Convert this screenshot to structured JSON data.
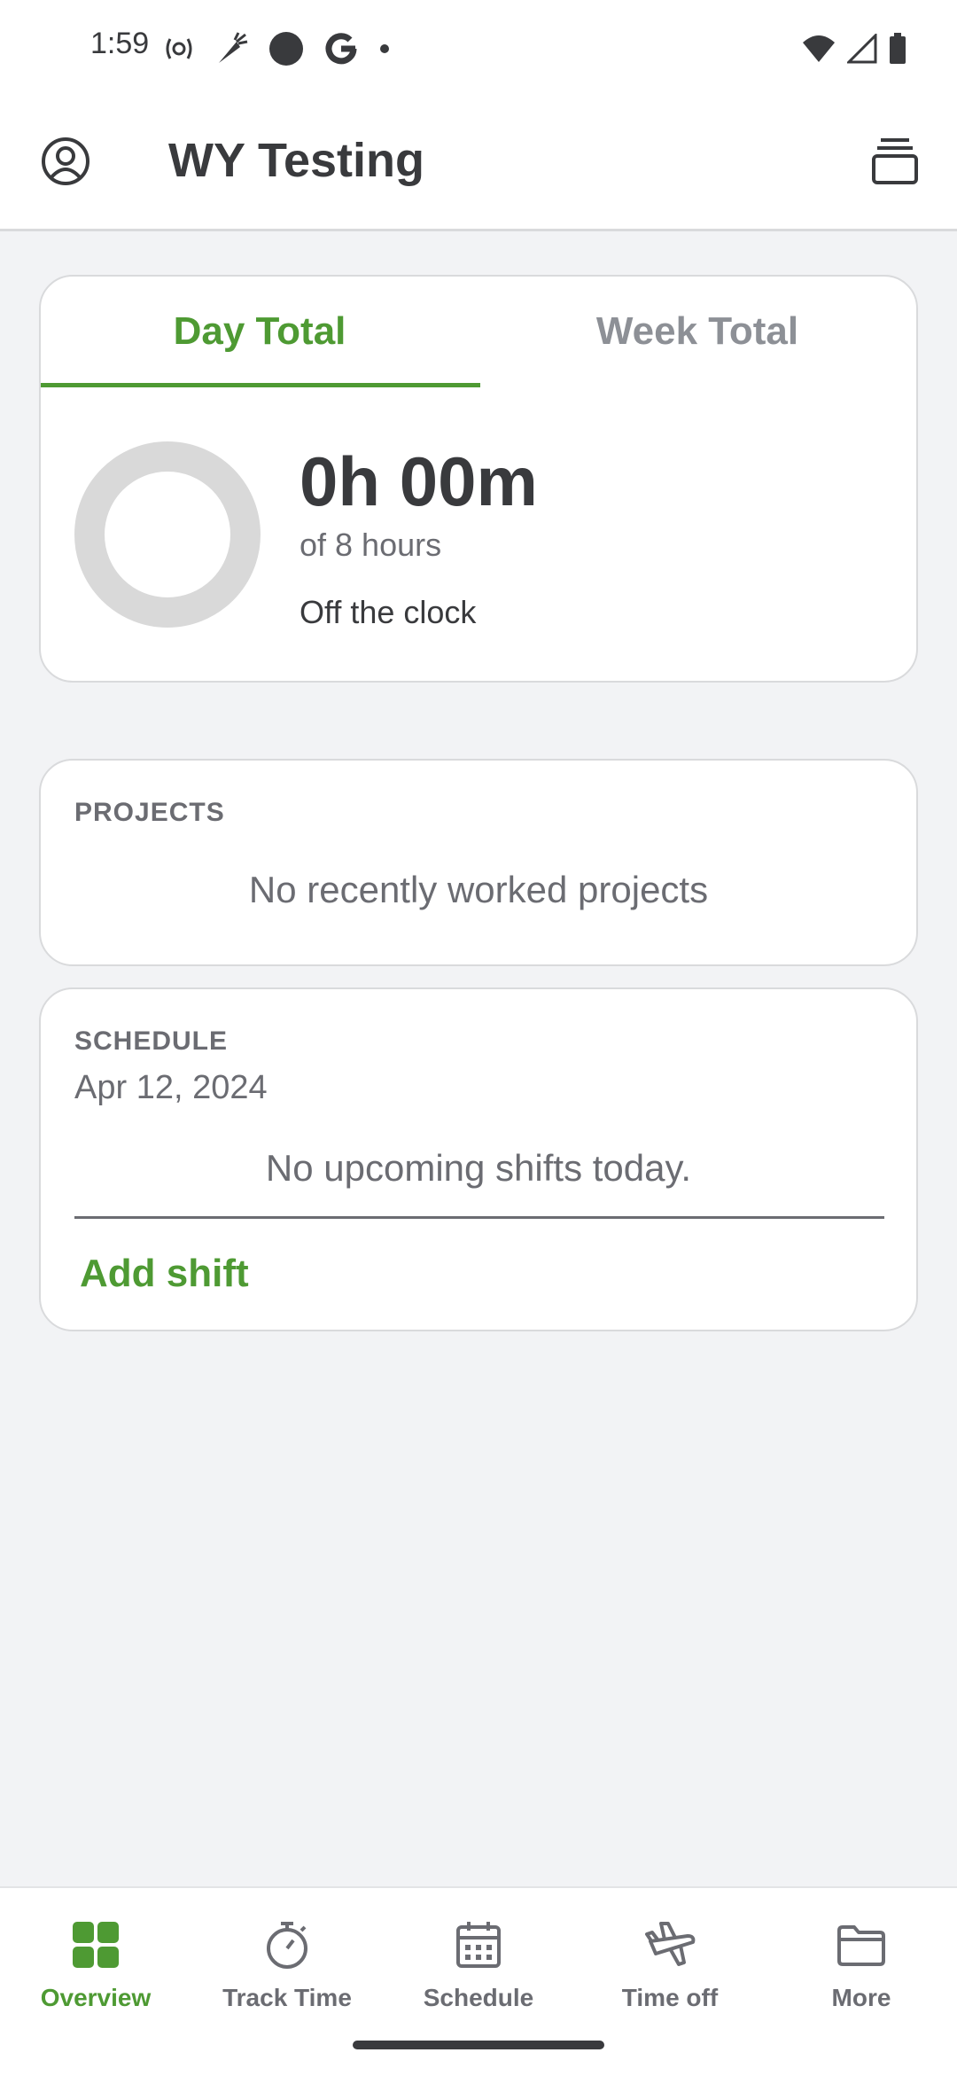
{
  "status_bar": {
    "time": "1:59",
    "left_icons": [
      "hotspot-icon",
      "carrot-icon",
      "dot-icon",
      "google-icon",
      "small-dot-icon"
    ],
    "right_icons": [
      "wifi-icon",
      "cell-signal-icon",
      "battery-icon"
    ]
  },
  "app_bar": {
    "title": "WY Testing",
    "left_icon": "profile-icon",
    "right_icon": "company-switch-icon"
  },
  "summary": {
    "tabs": [
      {
        "label": "Day Total",
        "selected": true
      },
      {
        "label": "Week Total",
        "selected": false
      }
    ],
    "total": "0h 00m",
    "target": "of 8 hours",
    "status": "Off the clock",
    "progress_fraction": 0
  },
  "projects": {
    "label": "PROJECTS",
    "empty_message": "No recently worked projects"
  },
  "schedule": {
    "label": "SCHEDULE",
    "date": "Apr 12, 2024",
    "empty_message": "No upcoming shifts today.",
    "add_label": "Add shift"
  },
  "bottom_nav": [
    {
      "label": "Overview",
      "icon": "overview-grid-icon",
      "active": true
    },
    {
      "label": "Track Time",
      "icon": "stopwatch-icon",
      "active": false
    },
    {
      "label": "Schedule",
      "icon": "calendar-icon",
      "active": false
    },
    {
      "label": "Time off",
      "icon": "airplane-icon",
      "active": false
    },
    {
      "label": "More",
      "icon": "folder-icon",
      "active": false
    }
  ],
  "colors": {
    "accent": "#4e9a33",
    "text_primary": "#393a3d",
    "text_secondary": "#6b6c72",
    "background": "#f2f3f5",
    "ring_track": "#d9d9d9"
  }
}
